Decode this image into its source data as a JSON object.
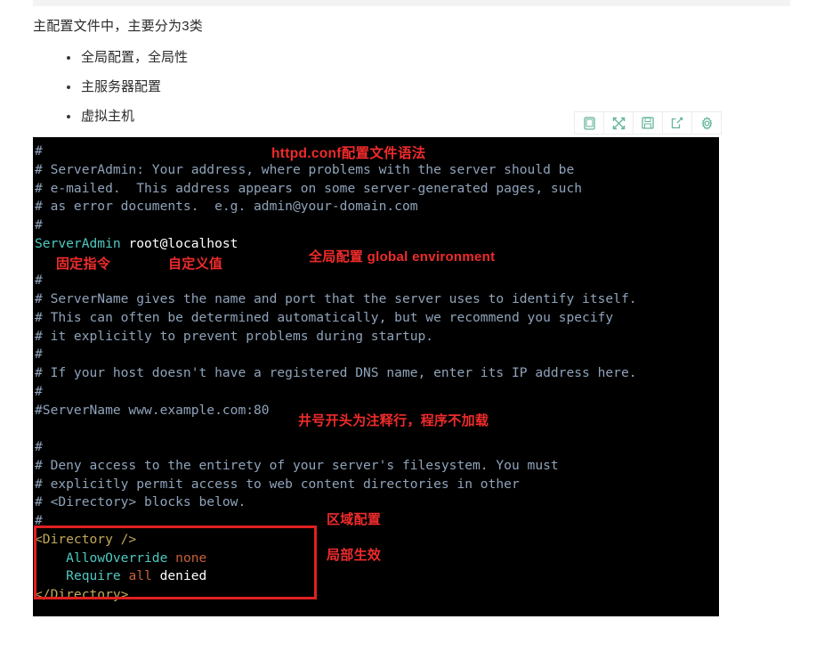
{
  "article": {
    "intro": "主配置文件中，主要分为3类",
    "bullets": [
      {
        "label": "全局配置，全局性"
      },
      {
        "label": "主服务器配置"
      },
      {
        "label": "虚拟主机"
      }
    ]
  },
  "toolbar": {
    "buttons": [
      {
        "icon": "mobile-preview-icon",
        "label": "手机预览"
      },
      {
        "icon": "fullscreen-icon",
        "label": "全屏"
      },
      {
        "icon": "save-icon",
        "label": "保存"
      },
      {
        "icon": "share-icon",
        "label": "分享"
      },
      {
        "icon": "gear-icon",
        "label": "设置"
      }
    ],
    "icon_color": "#63b59a"
  },
  "code": {
    "language": "apacheconf",
    "background": "#000000",
    "lines": [
      {
        "id": 1,
        "segments": [
          {
            "t": "#",
            "c": "cm"
          }
        ]
      },
      {
        "id": 2,
        "segments": [
          {
            "t": "# ServerAdmin: Your address, where problems with the server should be",
            "c": "cm"
          }
        ]
      },
      {
        "id": 3,
        "segments": [
          {
            "t": "# e-mailed.  This address appears on some server-generated pages, such",
            "c": "cm"
          }
        ]
      },
      {
        "id": 4,
        "segments": [
          {
            "t": "# as error documents.  e.g. admin@your-domain.com",
            "c": "cm"
          }
        ]
      },
      {
        "id": 5,
        "segments": [
          {
            "t": "#",
            "c": "cm"
          }
        ]
      },
      {
        "id": 6,
        "segments": [
          {
            "t": "ServerAdmin",
            "c": "dir"
          },
          {
            "t": " root@localhost",
            "c": "wht"
          }
        ]
      },
      {
        "id": 7,
        "segments": [
          {
            "t": "",
            "c": "cm"
          }
        ]
      },
      {
        "id": 8,
        "segments": [
          {
            "t": "#",
            "c": "cm"
          }
        ]
      },
      {
        "id": 9,
        "segments": [
          {
            "t": "# ServerName gives the name and port that the server uses to identify itself.",
            "c": "cm"
          }
        ]
      },
      {
        "id": 10,
        "segments": [
          {
            "t": "# This can often be determined automatically, but we recommend you specify",
            "c": "cm"
          }
        ]
      },
      {
        "id": 11,
        "segments": [
          {
            "t": "# it explicitly to prevent problems during startup.",
            "c": "cm"
          }
        ]
      },
      {
        "id": 12,
        "segments": [
          {
            "t": "#",
            "c": "cm"
          }
        ]
      },
      {
        "id": 13,
        "segments": [
          {
            "t": "# If your host doesn't have a registered DNS name, enter its IP address here.",
            "c": "cm"
          }
        ]
      },
      {
        "id": 14,
        "segments": [
          {
            "t": "#",
            "c": "cm"
          }
        ]
      },
      {
        "id": 15,
        "segments": [
          {
            "t": "#ServerName www.example.com:80",
            "c": "cm"
          }
        ]
      },
      {
        "id": 16,
        "segments": [
          {
            "t": "",
            "c": "cm"
          }
        ]
      },
      {
        "id": 17,
        "segments": [
          {
            "t": "#",
            "c": "cm"
          }
        ]
      },
      {
        "id": 18,
        "segments": [
          {
            "t": "# Deny access to the entirety of your server's filesystem. You must",
            "c": "cm"
          }
        ]
      },
      {
        "id": 19,
        "segments": [
          {
            "t": "# explicitly permit access to web content directories in other",
            "c": "cm"
          }
        ]
      },
      {
        "id": 20,
        "segments": [
          {
            "t": "# <Directory> blocks below.",
            "c": "cm"
          }
        ]
      },
      {
        "id": 21,
        "segments": [
          {
            "t": "#",
            "c": "cm"
          }
        ]
      },
      {
        "id": 22,
        "segments": [
          {
            "t": "<Directory />",
            "c": "tag"
          }
        ]
      },
      {
        "id": 23,
        "segments": [
          {
            "t": "    ",
            "c": "cm"
          },
          {
            "t": "AllowOverride",
            "c": "dir"
          },
          {
            "t": " none",
            "c": "val"
          }
        ]
      },
      {
        "id": 24,
        "segments": [
          {
            "t": "    ",
            "c": "cm"
          },
          {
            "t": "Require",
            "c": "dir"
          },
          {
            "t": " all",
            "c": "val"
          },
          {
            "t": " denied",
            "c": "wht"
          }
        ]
      },
      {
        "id": 25,
        "segments": [
          {
            "t": "</Directory>",
            "c": "tag"
          }
        ]
      }
    ]
  },
  "annotations": {
    "color": "#f02b2b",
    "title": "httpd.conf配置文件语法",
    "fixed_command": "固定指令",
    "custom_value": "自定义值",
    "global_config": "全局配置 global environment",
    "comment_note": "井号开头为注释行，程序不加载",
    "zone_config": "区域配置",
    "local_effect": "局部生效",
    "highlight_box_color": "#e02020"
  }
}
